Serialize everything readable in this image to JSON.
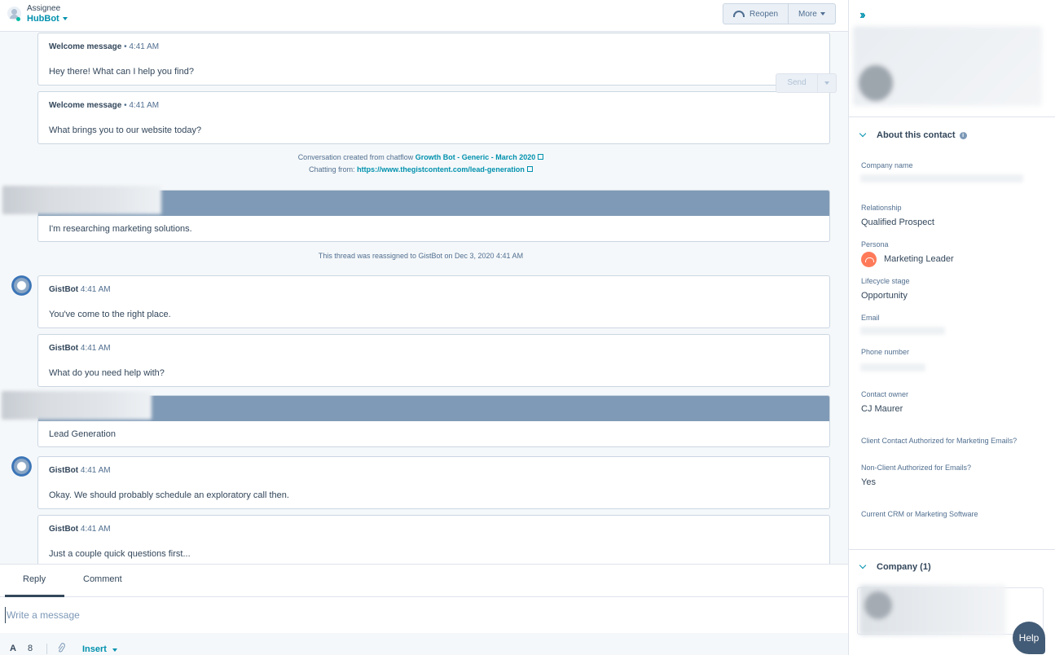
{
  "header": {
    "assignee_label": "Assignee",
    "assignee_name": "HubBot",
    "reopen_label": "Reopen",
    "more_label": "More"
  },
  "messages": [
    {
      "sender": "Welcome message",
      "sep": " • ",
      "time": "4:41 AM",
      "text": "Hey there! What can I help you find?"
    },
    {
      "sender": "Welcome message",
      "sep": " • ",
      "time": "4:41 AM",
      "text": "What brings you to our website today?"
    },
    {
      "sender": "",
      "time": "",
      "text": "I'm researching marketing solutions."
    },
    {
      "sender": "GistBot",
      "sep": "  ",
      "time": "4:41 AM",
      "text": "You've come to the right place."
    },
    {
      "sender": "GistBot",
      "sep": "  ",
      "time": "4:41 AM",
      "text": "What do you need help with?"
    },
    {
      "sender": "",
      "time": "",
      "text": "Lead Generation"
    },
    {
      "sender": "GistBot",
      "sep": "  ",
      "time": "4:41 AM",
      "text": "Okay. We should probably schedule an exploratory call then."
    },
    {
      "sender": "GistBot",
      "sep": "  ",
      "time": "4:41 AM",
      "text": "Just a couple quick questions first..."
    }
  ],
  "system": {
    "chatflow_prefix": "Conversation created from chatflow ",
    "chatflow_link": "Growth Bot - Generic - March 2020",
    "chatting_prefix": "Chatting from: ",
    "chatting_link": "https://www.thegistcontent.com/lead-generation",
    "reassigned": "This thread was reassigned to GistBot on Dec 3, 2020 4:41 AM"
  },
  "composer": {
    "tab_reply": "Reply",
    "tab_comment": "Comment",
    "placeholder": "Write a message",
    "insert_label": "Insert",
    "send_label": "Send",
    "format_icon": "A",
    "snippet_icon": "8",
    "attach_icon": "paperclip-icon"
  },
  "sidebar": {
    "about_title": "About this contact",
    "properties": [
      {
        "label": "Company name",
        "value": ""
      },
      {
        "label": "Relationship",
        "value": "Qualified Prospect"
      },
      {
        "label": "Persona",
        "value": "Marketing Leader"
      },
      {
        "label": "Lifecycle stage",
        "value": "Opportunity"
      },
      {
        "label": "Email",
        "value": ""
      },
      {
        "label": "Phone number",
        "value": ""
      },
      {
        "label": "Contact owner",
        "value": "CJ Maurer"
      },
      {
        "label": "Client Contact Authorized for Marketing Emails?",
        "value": ""
      },
      {
        "label": "Non-Client Authorized for Emails?",
        "value": "Yes"
      },
      {
        "label": "Current CRM or Marketing Software",
        "value": ""
      }
    ],
    "company_title": "Company (1)",
    "help_label": "Help"
  },
  "colors": {
    "accent": "#0091ae",
    "visitor_bar": "#7f9ab6",
    "persona": "#ff7a59",
    "help_bg": "#425b76"
  }
}
